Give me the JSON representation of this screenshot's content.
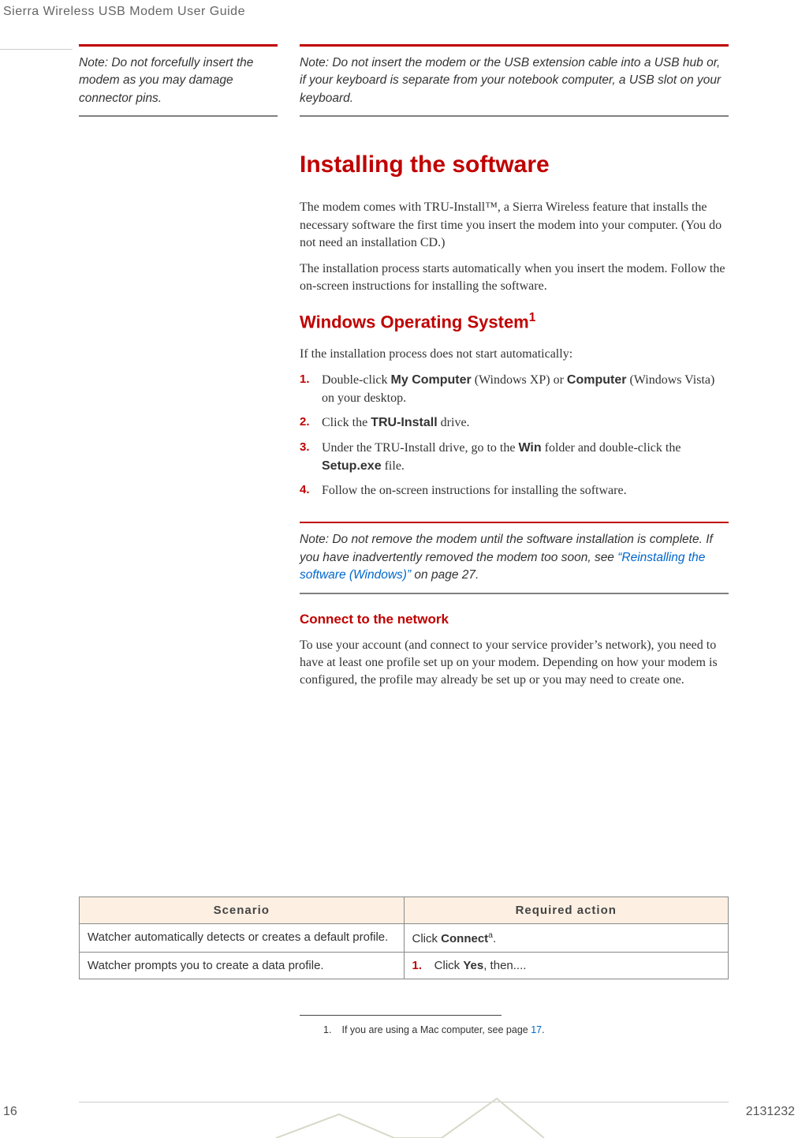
{
  "header": "Sierra Wireless USB Modem User Guide",
  "side_note": "Note:  Do not forcefully insert the modem as you may damage connector pins.",
  "main_note_top": "Note:  Do not insert the modem or the USB extension cable into a USB hub or, if your keyboard is separate from your notebook computer, a USB slot on your keyboard.",
  "h1": "Installing the software",
  "p1": "The modem comes with TRU-Install™, a Sierra Wireless feature that installs the necessary software the first time you insert the modem into your computer. (You do not need an installation CD.)",
  "p2": "The installation process starts automatically when you insert the modem. Follow the on-screen instructions for installing the software.",
  "h2": "Windows Operating System",
  "h2_sup": "1",
  "p3": "If the installation process does not start automatically:",
  "list": [
    {
      "num": "1.",
      "pre": "Double-click ",
      "b1": "My Computer",
      "mid": " (Windows XP) or ",
      "b2": "Computer",
      "post": " (Windows Vista) on your desktop."
    },
    {
      "num": "2.",
      "pre": "Click the ",
      "b1": "TRU-Install",
      "mid": "",
      "b2": "",
      "post": " drive."
    },
    {
      "num": "3.",
      "pre": "Under the TRU-Install drive, go to the ",
      "b1": "Win",
      "mid": " folder and double-click the ",
      "b2": "Setup.exe",
      "post": " file."
    },
    {
      "num": "4.",
      "pre": "Follow the on-screen instructions for installing the software.",
      "b1": "",
      "mid": "",
      "b2": "",
      "post": ""
    }
  ],
  "note_mid_pre": "Note:  Do not remove the modem until the software installation is complete. If you have inadvertently removed the modem too soon, see ",
  "note_mid_link": "“Reinstalling the software (Windows)”",
  "note_mid_post": " on page 27.",
  "h3": "Connect to the network",
  "p4": "To use your account (and connect to your service provider’s network), you need to have at least one profile set up on your modem. Depending on how your modem is configured, the profile may already be set up or you may need to create one.",
  "table": {
    "headers": [
      "Scenario",
      "Required action"
    ],
    "rows": [
      {
        "scenario": "Watcher automatically detects or creates a default profile.",
        "action_pre": "Click ",
        "action_bold": "Connect",
        "action_sup": "a",
        "action_post": "."
      },
      {
        "scenario": "Watcher prompts you to create a data profile.",
        "num": "1.",
        "action_pre": "Click ",
        "action_bold": "Yes",
        "action_post": ", then...."
      }
    ]
  },
  "footnote_num": "1.",
  "footnote_text": "If you are using a Mac computer, see page ",
  "footnote_link": "17",
  "footnote_post": ".",
  "page_left": "16",
  "page_right": "2131232"
}
